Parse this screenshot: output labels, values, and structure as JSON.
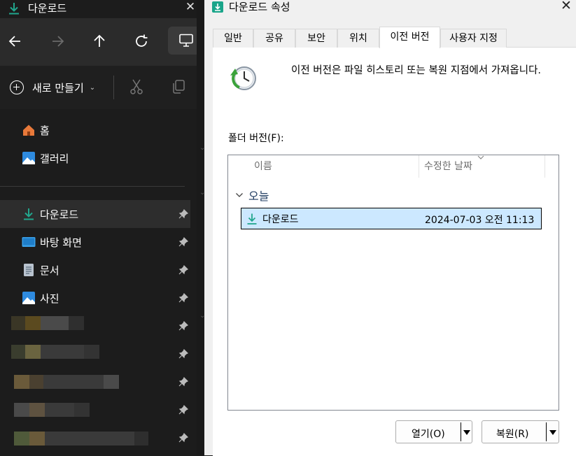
{
  "explorer": {
    "tab_title": "다운로드",
    "new_label": "새로 만들기",
    "nav_items": [
      {
        "label": "홈",
        "icon": "home-icon"
      },
      {
        "label": "갤러리",
        "icon": "gallery-icon"
      },
      {
        "label": "다운로드",
        "icon": "download-icon"
      },
      {
        "label": "바탕 화면",
        "icon": "desktop-icon"
      },
      {
        "label": "문서",
        "icon": "document-icon"
      },
      {
        "label": "사진",
        "icon": "pictures-icon"
      }
    ],
    "accent_color": "#21a68d"
  },
  "dialog": {
    "title": "다운로드 속성",
    "tabs": [
      "일반",
      "공유",
      "보안",
      "위치",
      "이전 버전",
      "사용자 지정"
    ],
    "selected_tab": "이전 버전",
    "description": "이전 버전은 파일 히스토리 또는 복원 지점에서 가져옵니다.",
    "folder_versions_label": "폴더 버전(F):",
    "columns": {
      "name": "이름",
      "modified": "수정한 날짜"
    },
    "group_label": "오늘",
    "rows": [
      {
        "name": "다운로드",
        "date": "2024-07-03 오전 11:13"
      }
    ],
    "open_button": "열기(O)",
    "restore_button": "복원(R)"
  }
}
